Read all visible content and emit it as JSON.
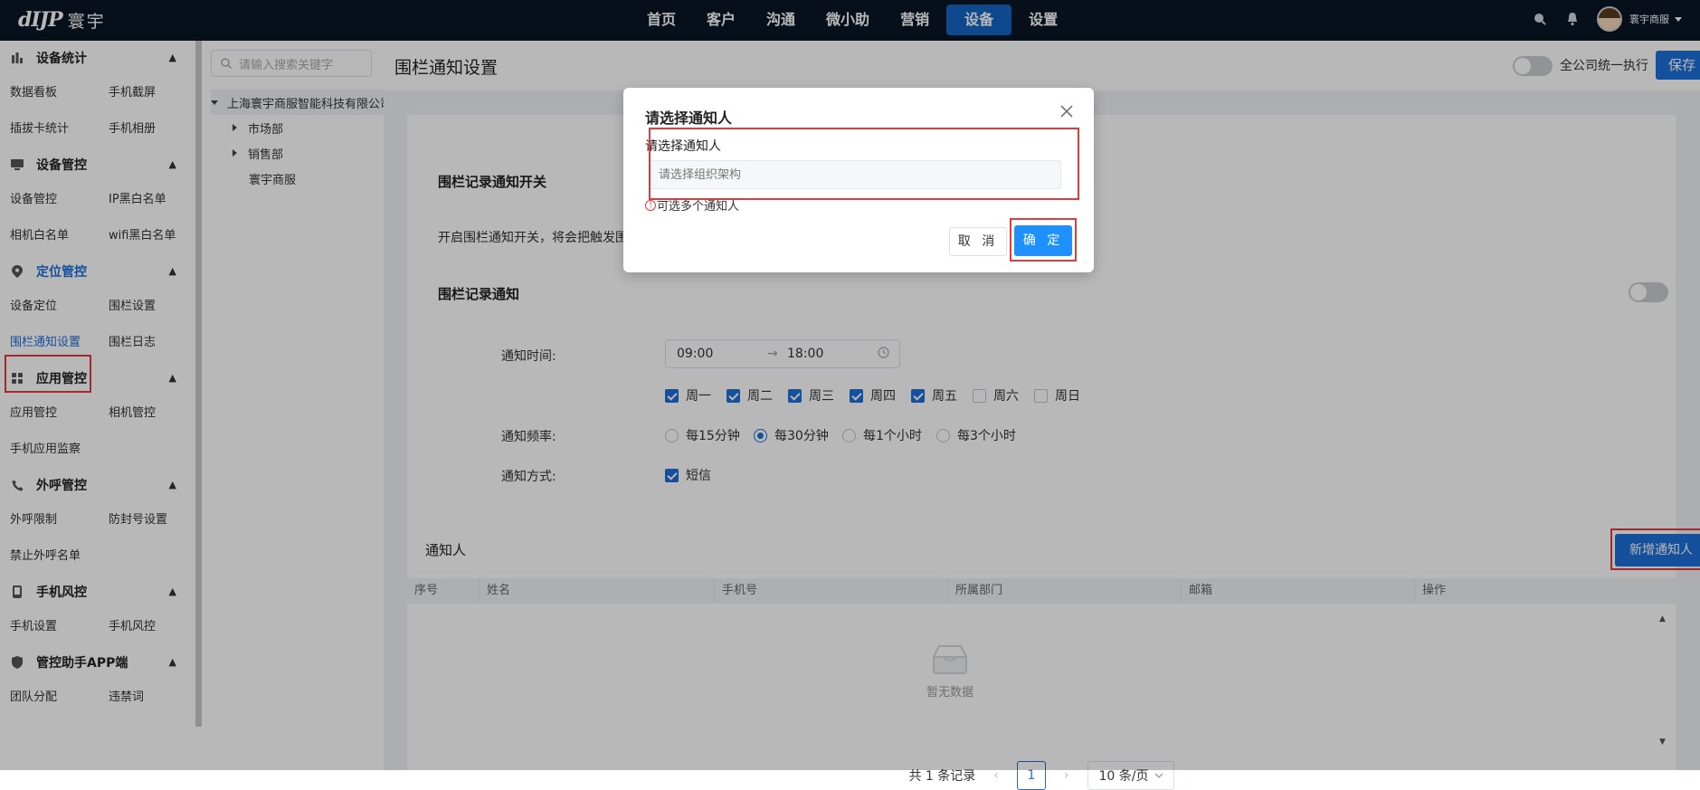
{
  "app": {
    "logo_mark": "dIJP",
    "logo_text": "寰宇"
  },
  "nav": [
    {
      "label": "首页",
      "active": false
    },
    {
      "label": "客户",
      "active": false
    },
    {
      "label": "沟通",
      "active": false
    },
    {
      "label": "微小助",
      "active": false
    },
    {
      "label": "营销",
      "active": false
    },
    {
      "label": "设备",
      "active": true
    },
    {
      "label": "设置",
      "active": false
    }
  ],
  "user": {
    "name": "寰宇商服",
    "icons": [
      "search-icon",
      "bell-icon"
    ]
  },
  "sidebar": {
    "groups": [
      {
        "title": "设备统计",
        "icon": "bar-chart-icon",
        "items": [
          "数据看板",
          "手机截屏",
          "插拔卡统计",
          "手机相册"
        ]
      },
      {
        "title": "设备管控",
        "icon": "monitor-icon",
        "items": [
          "设备管控",
          "IP黑白名单",
          "相机白名单",
          "wifi黑白名单"
        ]
      },
      {
        "title": "定位管控",
        "icon": "location-pin-icon",
        "active": true,
        "items": [
          "设备定位",
          "围栏设置",
          "围栏通知设置",
          "围栏日志"
        ],
        "active_item": "围栏通知设置"
      },
      {
        "title": "应用管控",
        "icon": "apps-icon",
        "items": [
          "应用管控",
          "相机管控",
          "手机应用监察"
        ]
      },
      {
        "title": "外呼管控",
        "icon": "phone-icon",
        "items": [
          "外呼限制",
          "防封号设置",
          "禁止外呼名单"
        ]
      },
      {
        "title": "手机风控",
        "icon": "mobile-icon",
        "items": [
          "手机设置",
          "手机风控"
        ]
      },
      {
        "title": "管控助手APP端",
        "icon": "shield-icon",
        "items": [
          "团队分配",
          "违禁词"
        ]
      }
    ]
  },
  "tree": {
    "search_placeholder": "请输入搜索关键字",
    "root": "上海寰宇商服智能科技有限公司",
    "children": [
      "市场部",
      "销售部",
      "寰宇商服"
    ]
  },
  "page": {
    "title": "围栏通知设置",
    "unify_label": "全公司统一执行",
    "save_label": "保存"
  },
  "section1": {
    "title": "围栏记录通知开关",
    "desc": "开启围栏通知开关，将会把触发围"
  },
  "section2": {
    "title": "围栏记录通知",
    "time_label": "通知时间:",
    "time_start": "09:00",
    "time_arrow": "→",
    "time_end": "18:00",
    "weekdays": [
      {
        "label": "周一",
        "checked": true
      },
      {
        "label": "周二",
        "checked": true
      },
      {
        "label": "周三",
        "checked": true
      },
      {
        "label": "周四",
        "checked": true
      },
      {
        "label": "周五",
        "checked": true
      },
      {
        "label": "周六",
        "checked": false
      },
      {
        "label": "周日",
        "checked": false
      }
    ],
    "freq_label": "通知频率:",
    "freq_options": [
      {
        "label": "每15分钟",
        "selected": false
      },
      {
        "label": "每30分钟",
        "selected": true
      },
      {
        "label": "每1个小时",
        "selected": false
      },
      {
        "label": "每3个小时",
        "selected": false
      }
    ],
    "method_label": "通知方式:",
    "method_option": "短信"
  },
  "notify": {
    "title": "通知人",
    "add_button": "新增通知人",
    "columns": [
      "序号",
      "姓名",
      "手机号",
      "所属部门",
      "邮箱",
      "操作"
    ],
    "empty_text": "暂无数据",
    "pager": {
      "total": "共 1 条记录",
      "page": "1",
      "size": "10 条/页"
    }
  },
  "modal": {
    "title": "请选择通知人",
    "field_label": "请选择通知人",
    "input_placeholder": "请选择组织架构",
    "hint": "可选多个通知人",
    "hint_icon": "!",
    "cancel": "取 消",
    "ok": "确 定"
  },
  "colors": {
    "accent": "#1e6fd9",
    "topbar": "#0a1526",
    "highlight": "#e03c3c"
  }
}
